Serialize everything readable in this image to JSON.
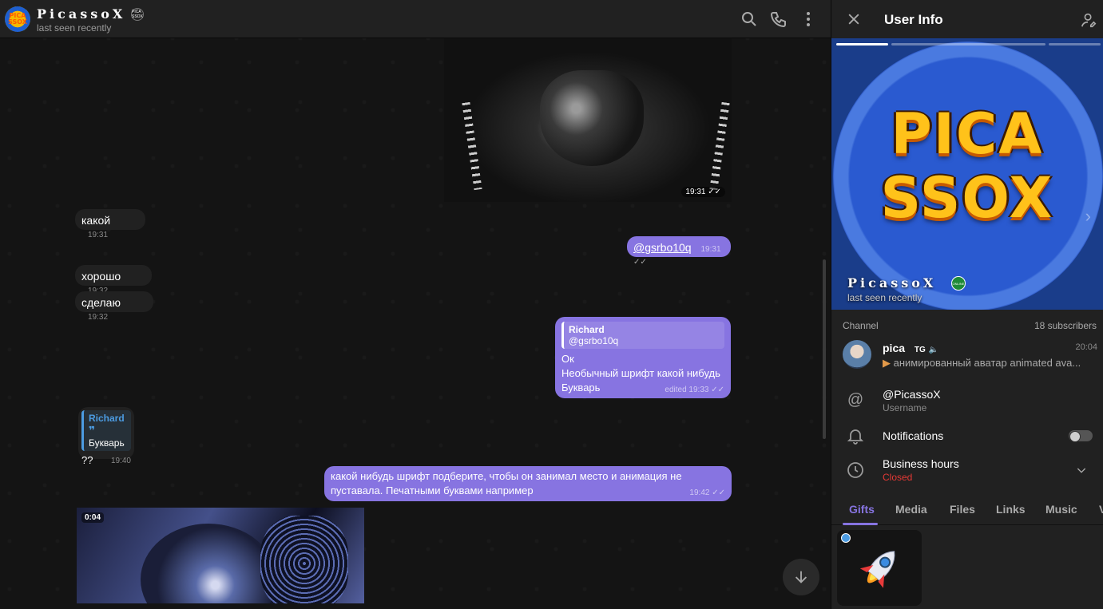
{
  "chat": {
    "title": "PicassoX",
    "title_badge": "PICA SSOX",
    "status": "last seen recently",
    "avatar_text": "PICA SSOX",
    "messages": {
      "img1_time": "19:31",
      "m1_text": "какой",
      "m1_time": "19:31",
      "m2_text": "@gsrbo10q",
      "m2_time": "19:31",
      "m3_text": "хорошо",
      "m3_time": "19:32",
      "m4_text": "сделаю",
      "m4_time": "19:32",
      "m5_reply_name": "Richard",
      "m5_reply_text": "@gsrbo10q",
      "m5_line1": "Ок",
      "m5_line2": "Необычный шрифт какой нибудь",
      "m5_line3": "Букварь",
      "m5_time": "edited 19:33",
      "m6_reply_name": "Richard",
      "m6_reply_text": "Букварь",
      "m6_text": "??",
      "m6_time": "19:40",
      "m7_line1": "какой нибудь шрифт подберите, чтобы он занимал место и анимация не",
      "m7_line2": "пуставала. Печатными буквами например",
      "m7_time": "19:42",
      "video_duration": "0:04"
    }
  },
  "panel": {
    "title": "User Info",
    "photo_text_line1": "PICA",
    "photo_text_line2": "SSOX",
    "name": "PicassoX",
    "online_badge": "ONLINE",
    "status": "last seen recently",
    "channel_label": "Channel",
    "subscribers": "18 subscribers",
    "channel_name": "pica",
    "channel_name_suffix": "TG",
    "channel_time": "20:04",
    "channel_preview": "анимированный аватар animated ava...",
    "username": "@PicassoX",
    "username_label": "Username",
    "notifications_label": "Notifications",
    "notifications_on": false,
    "business_hours_label": "Business hours",
    "business_hours_status": "Closed",
    "tabs": [
      "Gifts",
      "Media",
      "Files",
      "Links",
      "Music",
      "V"
    ],
    "active_tab": "Gifts"
  },
  "colors": {
    "accent": "#8774e1",
    "bubble_in": "#212121",
    "closed": "#e53935",
    "link": "#4c9ce2"
  }
}
